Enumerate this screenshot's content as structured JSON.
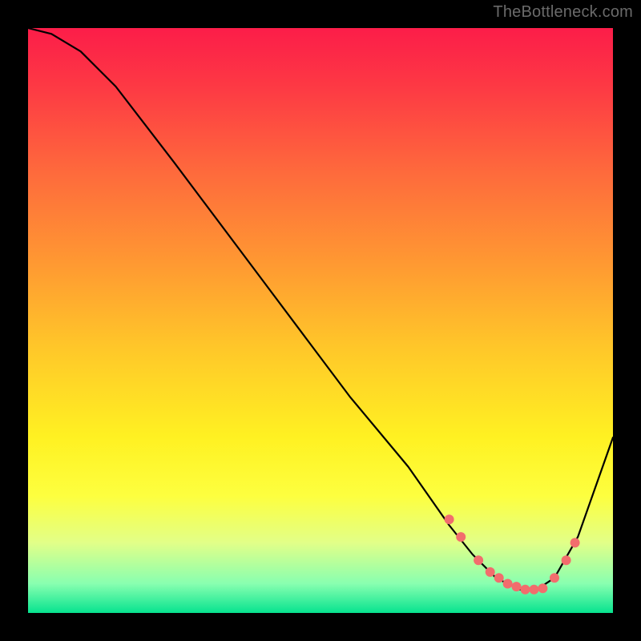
{
  "attribution": "TheBottleneck.com",
  "chart_data": {
    "type": "line",
    "title": "",
    "xlabel": "",
    "ylabel": "",
    "xlim": [
      0,
      100
    ],
    "ylim": [
      0,
      100
    ],
    "grid": false,
    "legend": null,
    "gradient_stops": [
      {
        "pct": 0,
        "color": "#fc1d49"
      },
      {
        "pct": 10,
        "color": "#fd3944"
      },
      {
        "pct": 25,
        "color": "#fe6b3c"
      },
      {
        "pct": 40,
        "color": "#ff9832"
      },
      {
        "pct": 55,
        "color": "#ffc829"
      },
      {
        "pct": 70,
        "color": "#fff122"
      },
      {
        "pct": 80,
        "color": "#fdff3f"
      },
      {
        "pct": 88,
        "color": "#e2ff88"
      },
      {
        "pct": 95,
        "color": "#88ffb0"
      },
      {
        "pct": 100,
        "color": "#07e38f"
      }
    ],
    "series": [
      {
        "name": "bottleneck-curve",
        "x": [
          0,
          4,
          9,
          15,
          25,
          40,
          55,
          65,
          72,
          76,
          80,
          84,
          87,
          90,
          94,
          100
        ],
        "y": [
          100,
          99,
          96,
          90,
          77,
          57,
          37,
          25,
          15,
          10,
          6,
          4,
          4,
          6,
          13,
          30
        ]
      }
    ],
    "highlighted_points": {
      "name": "recommended-range-dots",
      "color": "#f26d6d",
      "x": [
        72,
        74,
        77,
        79,
        80.5,
        82,
        83.5,
        85,
        86.5,
        88,
        90,
        92,
        93.5
      ],
      "y": [
        16,
        13,
        9,
        7,
        6,
        5,
        4.5,
        4,
        4,
        4.2,
        6,
        9,
        12
      ]
    }
  }
}
